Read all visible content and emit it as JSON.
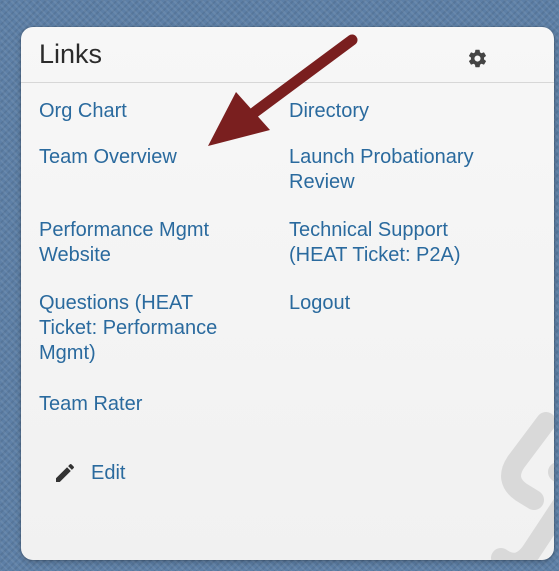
{
  "widget": {
    "title": "Links",
    "settings_icon": "gear-icon",
    "edit_label": "Edit",
    "edit_icon": "pencil-icon",
    "watermark_icon": "chain-link-icon"
  },
  "links": {
    "left": [
      {
        "label": "Org Chart"
      },
      {
        "label": "Team Overview"
      },
      {
        "label": "Performance Mgmt\nWebsite"
      },
      {
        "label": "Questions (HEAT\nTicket: Performance\nMgmt)"
      },
      {
        "label": "Team Rater"
      }
    ],
    "right": [
      {
        "label": "Directory"
      },
      {
        "label": "Launch Probationary\nReview"
      },
      {
        "label": "Technical Support\n(HEAT Ticket: P2A)"
      },
      {
        "label": "Logout"
      }
    ]
  },
  "annotation": {
    "type": "arrow",
    "color": "#7a1f1f"
  },
  "colors": {
    "link": "#2a6a9e",
    "background": "#5d7fa6",
    "card": "#f4f4f4"
  }
}
